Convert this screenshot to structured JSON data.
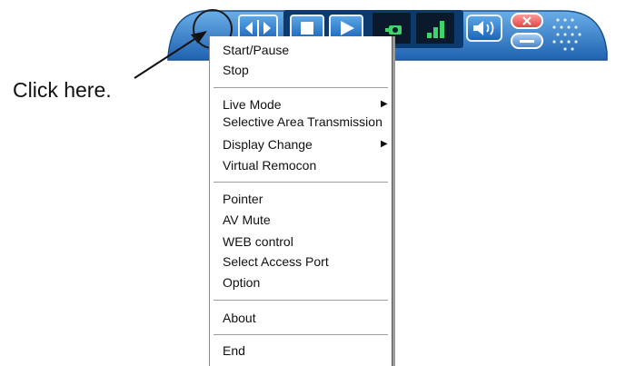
{
  "callout": {
    "text": "Click here."
  },
  "toolbar": {
    "colors": {
      "bar": "#2f78c4",
      "button": "#3a8ad8",
      "screen": "#0a1a2c",
      "close": "#e85a5a"
    },
    "buttons": [
      {
        "name": "menu-button",
        "icon": "circle-outline"
      },
      {
        "name": "display-change-button",
        "icon": "left-right-arrows-icon"
      },
      {
        "name": "stop-button",
        "icon": "stop-icon"
      },
      {
        "name": "play-button",
        "icon": "play-icon"
      },
      {
        "name": "live-mode-button",
        "icon": "camera-icon"
      },
      {
        "name": "signal-button",
        "icon": "signal-bars-icon"
      },
      {
        "name": "volume-button",
        "icon": "speaker-icon"
      },
      {
        "name": "close-button",
        "icon": "close-icon"
      },
      {
        "name": "minimize-button",
        "icon": "minimize-icon"
      }
    ]
  },
  "menu": {
    "items": [
      {
        "label": "Start/Pause"
      },
      {
        "label": "Stop"
      },
      {
        "label": "Live Mode",
        "submenu": true
      },
      {
        "label": "Selective Area Transmission"
      },
      {
        "label": "Display Change",
        "submenu": true
      },
      {
        "label": "Virtual Remocon"
      },
      {
        "label": "Pointer"
      },
      {
        "label": "AV Mute"
      },
      {
        "label": "WEB control"
      },
      {
        "label": "Select Access Port"
      },
      {
        "label": "Option"
      },
      {
        "label": "About"
      },
      {
        "label": "End"
      }
    ]
  }
}
